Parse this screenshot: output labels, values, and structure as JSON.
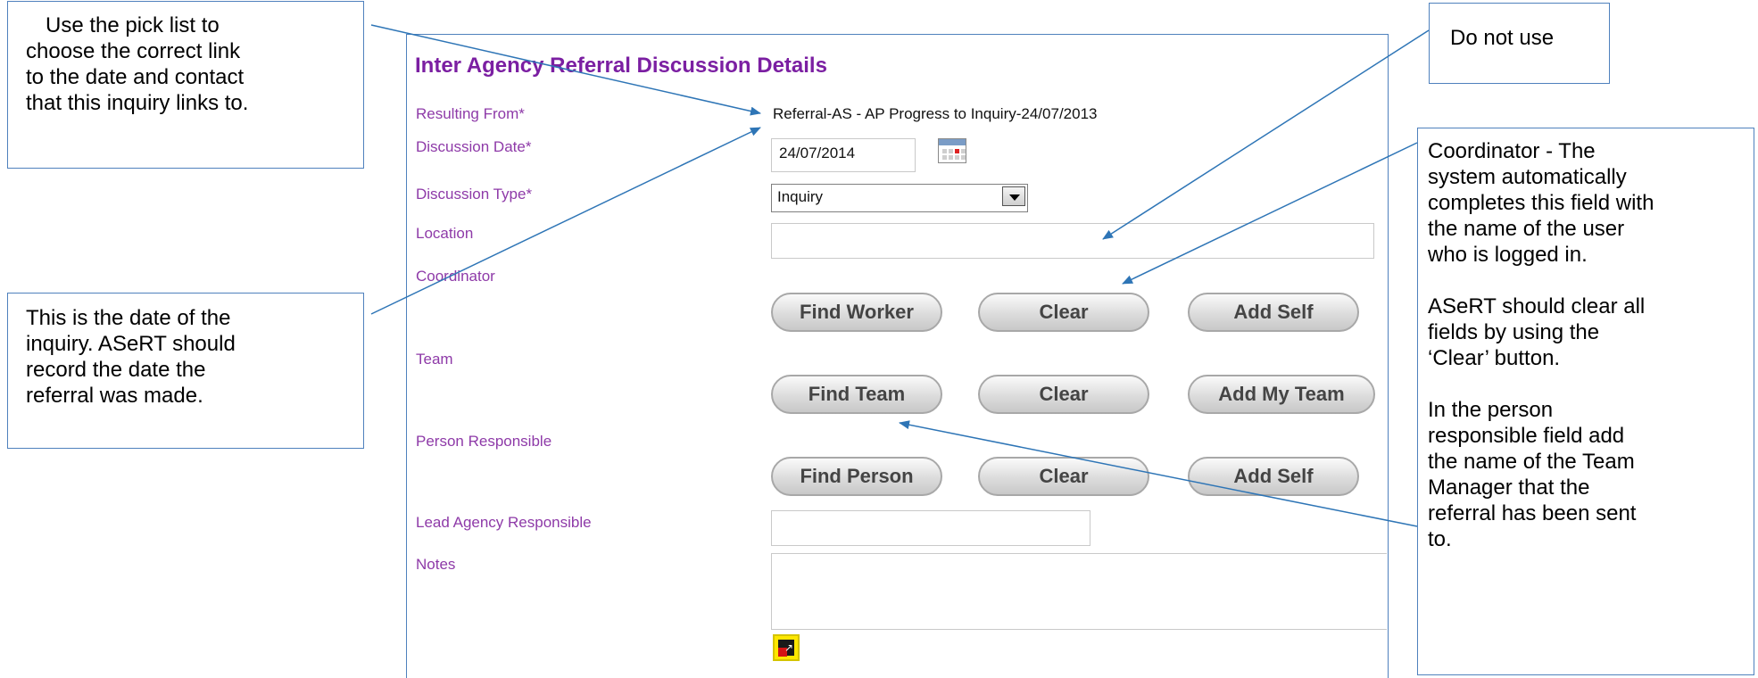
{
  "form": {
    "title": "Inter Agency Referral Discussion Details",
    "fields": {
      "resulting_from": {
        "label": "Resulting From*",
        "value": "Referral-AS - AP Progress to Inquiry-24/07/2013"
      },
      "discussion_date": {
        "label": "Discussion Date*",
        "value": "24/07/2014"
      },
      "discussion_type": {
        "label": "Discussion Type*",
        "value": "Inquiry"
      },
      "location": {
        "label": "Location",
        "value": ""
      },
      "coordinator": {
        "label": "Coordinator"
      },
      "team": {
        "label": "Team"
      },
      "person_responsible": {
        "label": "Person Responsible"
      },
      "lead_agency": {
        "label": "Lead Agency Responsible",
        "value": ""
      },
      "notes": {
        "label": "Notes",
        "value": ""
      }
    },
    "buttons": {
      "find_worker": "Find Worker",
      "coordinator_clear": "Clear",
      "coordinator_add_self": "Add Self",
      "find_team": "Find Team",
      "team_clear": "Clear",
      "add_my_team": "Add My Team",
      "find_person": "Find Person",
      "person_clear": "Clear",
      "person_add_self": "Add Self"
    }
  },
  "callouts": {
    "pick_list": [
      "Use the pick list to",
      "choose the correct link",
      "to the date and contact",
      "that this inquiry links to."
    ],
    "date": [
      "This is the date of the",
      "inquiry. ASeRT should",
      "record the date the",
      "referral was made."
    ],
    "do_not_use": [
      "Do not use"
    ],
    "coordinator": {
      "p1": [
        "Coordinator - The",
        "system automatically",
        "completes this field with",
        "the name of the user",
        "who is logged in."
      ],
      "p2": [
        "ASeRT should clear all",
        "fields by using the",
        "‘Clear’ button."
      ],
      "p3": [
        "In the person",
        "responsible field add",
        "the name of the Team",
        "Manager that the",
        "referral has been sent",
        "to."
      ]
    }
  },
  "colors": {
    "accent_line": "#2e75b6",
    "label": "#8e3aa8",
    "title": "#7b1fa2"
  }
}
